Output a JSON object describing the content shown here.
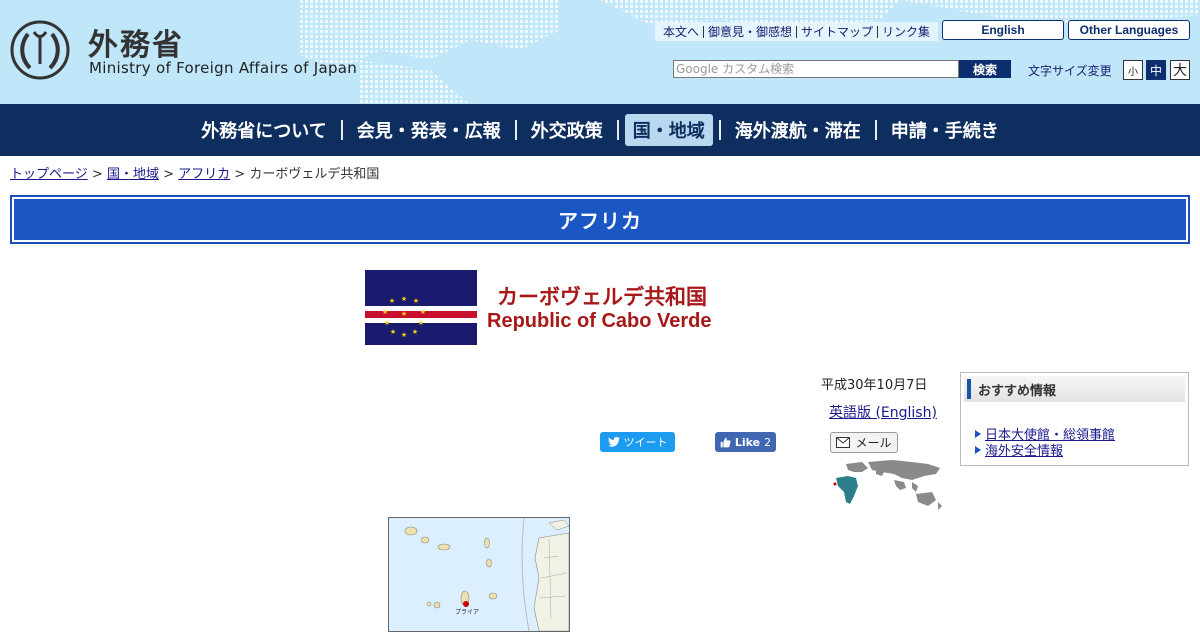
{
  "header": {
    "logo_jp": "外務省",
    "logo_en": "Ministry of Foreign Affairs of Japan",
    "utility_links": [
      "本文へ",
      "御意見・御感想",
      "サイトマップ",
      "リンク集"
    ],
    "english_button": "English",
    "other_languages_button": "Other Languages",
    "search_placeholder": "Google カスタム検索",
    "search_button": "検索",
    "font_size_label": "文字サイズ変更",
    "font_size_small": "小",
    "font_size_medium": "中",
    "font_size_large": "大"
  },
  "nav": {
    "items": [
      "外務省について",
      "会見・発表・広報",
      "外交政策",
      "国・地域",
      "海外渡航・滞在",
      "申請・手続き"
    ],
    "active_index": 3
  },
  "breadcrumb": {
    "items": [
      "トップページ",
      "国・地域",
      "アフリカ"
    ],
    "separator": ">",
    "current": "カーボヴェルデ共和国"
  },
  "region": {
    "title": "アフリカ"
  },
  "country": {
    "name_jp": "カーボヴェルデ共和国",
    "name_en": "Republic of Cabo Verde",
    "date": "平成30年10月7日",
    "english_link": "英語版 (English)",
    "map_city_label": "プライア"
  },
  "social": {
    "tweet_label": "ツイート",
    "like_label": "Like",
    "like_count": "2",
    "mail_label": "メール"
  },
  "sidebar": {
    "recommend_title": "おすすめ情報",
    "links": [
      "日本大使館・総領事館",
      "海外安全情報"
    ]
  },
  "colors": {
    "nav_bg": "#0d2e5e",
    "region_bar": "#1a56c4",
    "country_title": "#a81818",
    "link": "#1a1a8e"
  }
}
